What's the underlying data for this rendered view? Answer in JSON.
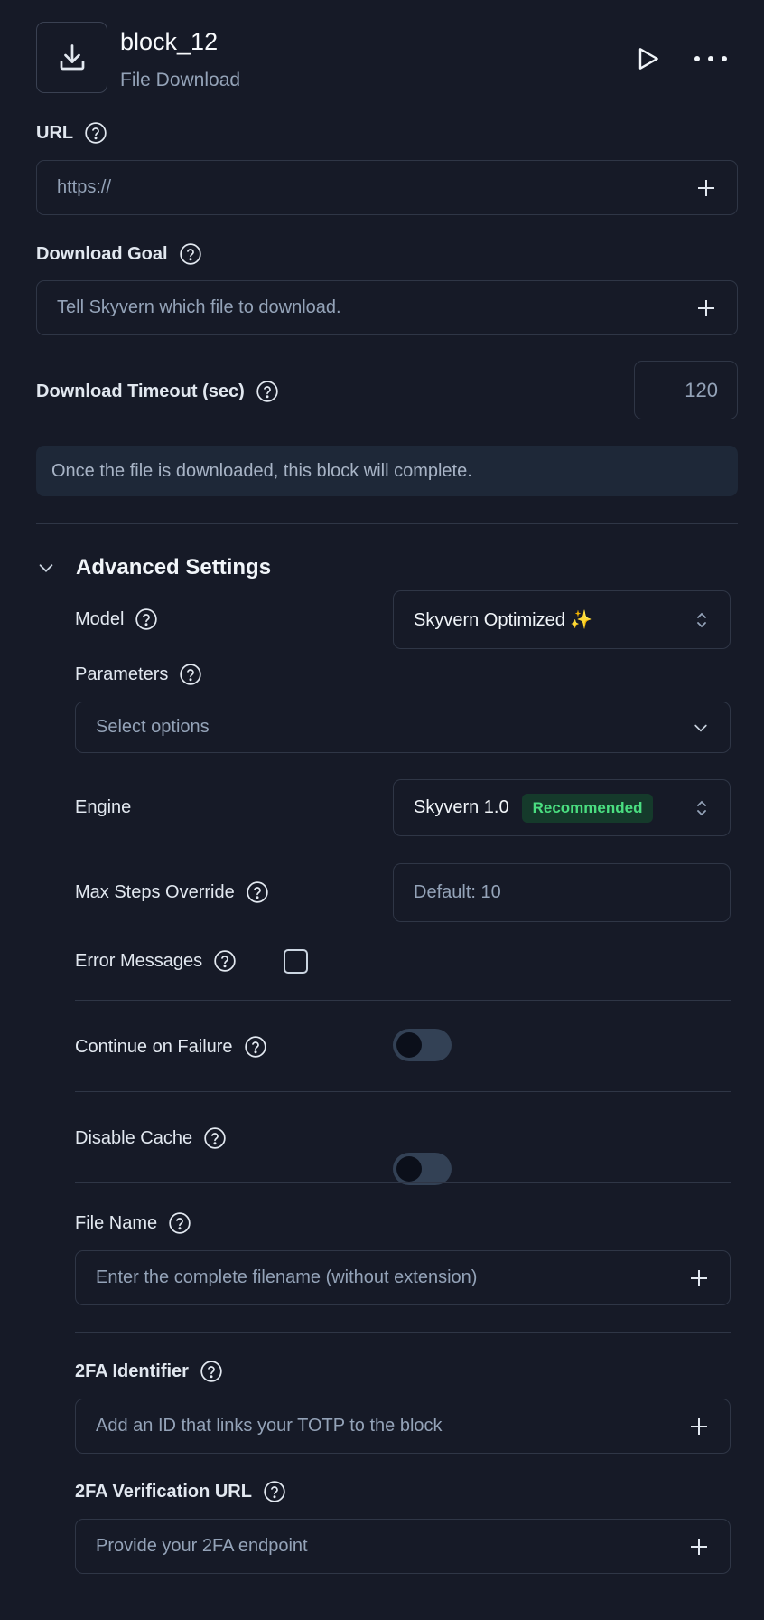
{
  "header": {
    "title": "block_12",
    "subtitle": "File Download"
  },
  "url": {
    "label": "URL",
    "placeholder": "https://"
  },
  "download_goal": {
    "label": "Download Goal",
    "placeholder": "Tell Skyvern which file to download."
  },
  "download_timeout": {
    "label": "Download Timeout (sec)",
    "value": "120"
  },
  "info_text": "Once the file is downloaded, this block will complete.",
  "advanced": {
    "title": "Advanced Settings",
    "model": {
      "label": "Model",
      "value": "Skyvern Optimized ✨"
    },
    "parameters": {
      "label": "Parameters",
      "placeholder": "Select options"
    },
    "engine": {
      "label": "Engine",
      "value": "Skyvern 1.0",
      "badge": "Recommended"
    },
    "max_steps": {
      "label": "Max Steps Override",
      "placeholder": "Default: 10"
    },
    "error_messages": {
      "label": "Error Messages",
      "checked": false
    },
    "continue_on_failure": {
      "label": "Continue on Failure",
      "enabled": false
    },
    "disable_cache": {
      "label": "Disable Cache",
      "enabled": false
    },
    "file_name": {
      "label": "File Name",
      "placeholder": "Enter the complete filename (without extension)"
    },
    "twofa_identifier": {
      "label": "2FA Identifier",
      "placeholder": "Add an ID that links your TOTP to the block"
    },
    "twofa_url": {
      "label": "2FA Verification URL",
      "placeholder": "Provide your 2FA endpoint"
    }
  },
  "colors": {
    "background": "#161a27",
    "border": "#2f3646",
    "badge_bg": "#153a2b",
    "badge_text": "#4ade80"
  }
}
